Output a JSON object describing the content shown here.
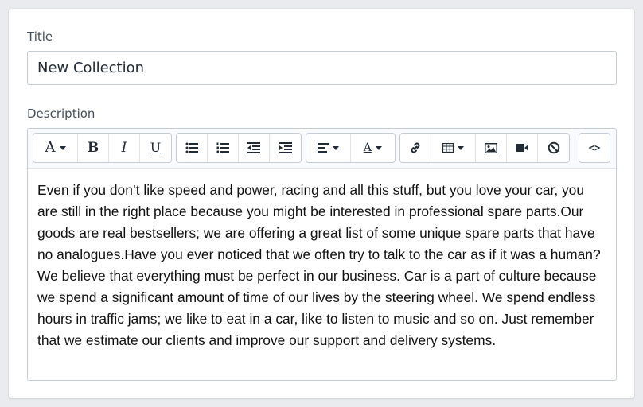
{
  "form": {
    "title_label": "Title",
    "title_value": "New Collection",
    "description_label": "Description",
    "description_text": "Even if you don’t like speed and power, racing and all this stuff, but you love your car, you are still in the right place because you might be interested in professional spare parts.Our goods are real bestsellers; we are offering a great list of some unique spare parts that have no analogues.Have you ever noticed that we often try to talk to the car as if it was a human? We believe that everything must be perfect in our business. Car is a part of culture because we spend a significant amount of time of our lives by the steering wheel. We spend endless hours in traffic jams; we like to eat in a car, like to listen to music and so on. Just remember that we estimate our clients and improve our support and delivery systems."
  },
  "toolbar": {
    "font_glyph": "A",
    "bold_glyph": "B",
    "italic_glyph": "I",
    "underline_glyph": "U",
    "color_glyph": "A",
    "code_glyph": "<>",
    "icons": [
      "font-style-icon",
      "bold-icon",
      "italic-icon",
      "underline-icon",
      "bullet-list-icon",
      "numbered-list-icon",
      "outdent-icon",
      "indent-icon",
      "align-left-icon",
      "text-color-icon",
      "link-icon",
      "table-icon",
      "image-icon",
      "video-icon",
      "clear-format-icon",
      "code-view-icon"
    ]
  },
  "colors": {
    "background": "#e9ebee",
    "border": "#c4cdd5",
    "text": "#212b36"
  }
}
